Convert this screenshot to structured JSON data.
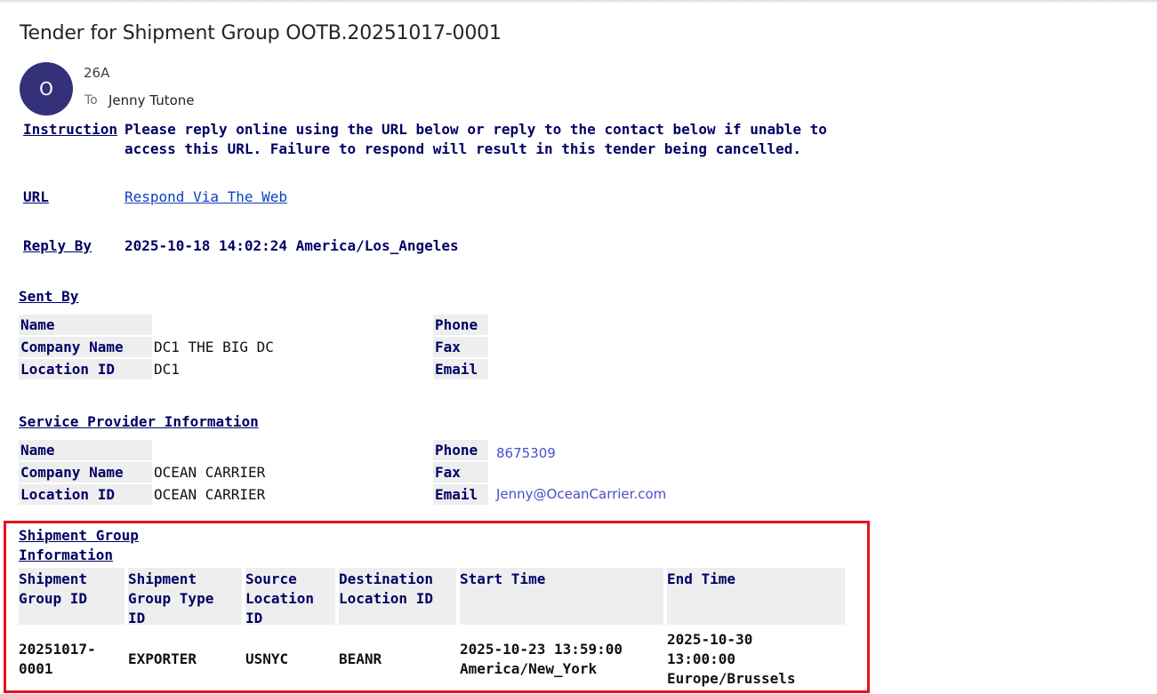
{
  "email": {
    "subject": "Tender for Shipment Group OOTB.20251017-0001",
    "avatar_initial": "O",
    "sender": "26A",
    "to_label": "To",
    "to_name": "Jenny Tutone"
  },
  "instruction": {
    "label": "Instruction",
    "line1": "Please reply online using the URL below or reply to the contact below if unable to",
    "line2": "access this URL. Failure to respond will result in this tender being cancelled."
  },
  "url": {
    "label": "URL",
    "link_text": "Respond Via The Web"
  },
  "reply_by": {
    "label": "Reply By",
    "value": "2025-10-18 14:02:24 America/Los_Angeles"
  },
  "sent_by": {
    "title": "Sent By",
    "name_label": "Name",
    "name_value": "",
    "company_label": "Company Name",
    "company_value": "DC1 THE BIG DC",
    "location_label": "Location ID",
    "location_value": "DC1",
    "phone_label": "Phone",
    "phone_value": "",
    "fax_label": "Fax",
    "fax_value": "",
    "email_label": "Email",
    "email_value": ""
  },
  "service_provider": {
    "title": "Service Provider Information",
    "name_label": "Name",
    "name_value": "",
    "company_label": "Company Name",
    "company_value": "OCEAN CARRIER",
    "location_label": "Location ID",
    "location_value": "OCEAN CARRIER",
    "phone_label": "Phone",
    "phone_value": "8675309",
    "fax_label": "Fax",
    "fax_value": "",
    "email_label": "Email",
    "email_value": "Jenny@OceanCarrier.com"
  },
  "shipment_group": {
    "title_line1": "Shipment Group",
    "title_line2": "Information",
    "headers": [
      [
        "Shipment",
        "Group ID",
        ""
      ],
      [
        "Shipment",
        "Group Type",
        "ID"
      ],
      [
        "Source",
        "Location",
        "ID"
      ],
      [
        "Destination",
        "Location ID",
        ""
      ],
      [
        "Start Time",
        "",
        ""
      ],
      [
        "End Time",
        "",
        ""
      ]
    ],
    "row": [
      [
        "20251017-",
        "0001",
        ""
      ],
      [
        "EXPORTER",
        "",
        ""
      ],
      [
        "USNYC",
        "",
        ""
      ],
      [
        "BEANR",
        "",
        ""
      ],
      [
        "2025-10-23 13:59:00",
        "America/New_York",
        ""
      ],
      [
        "2025-10-30",
        "13:00:00",
        "Europe/Brussels"
      ]
    ]
  },
  "colors": {
    "navy": "#000066",
    "avatar": "#35307a",
    "highlight_border": "#e0161d",
    "link": "#0b3fc4"
  }
}
